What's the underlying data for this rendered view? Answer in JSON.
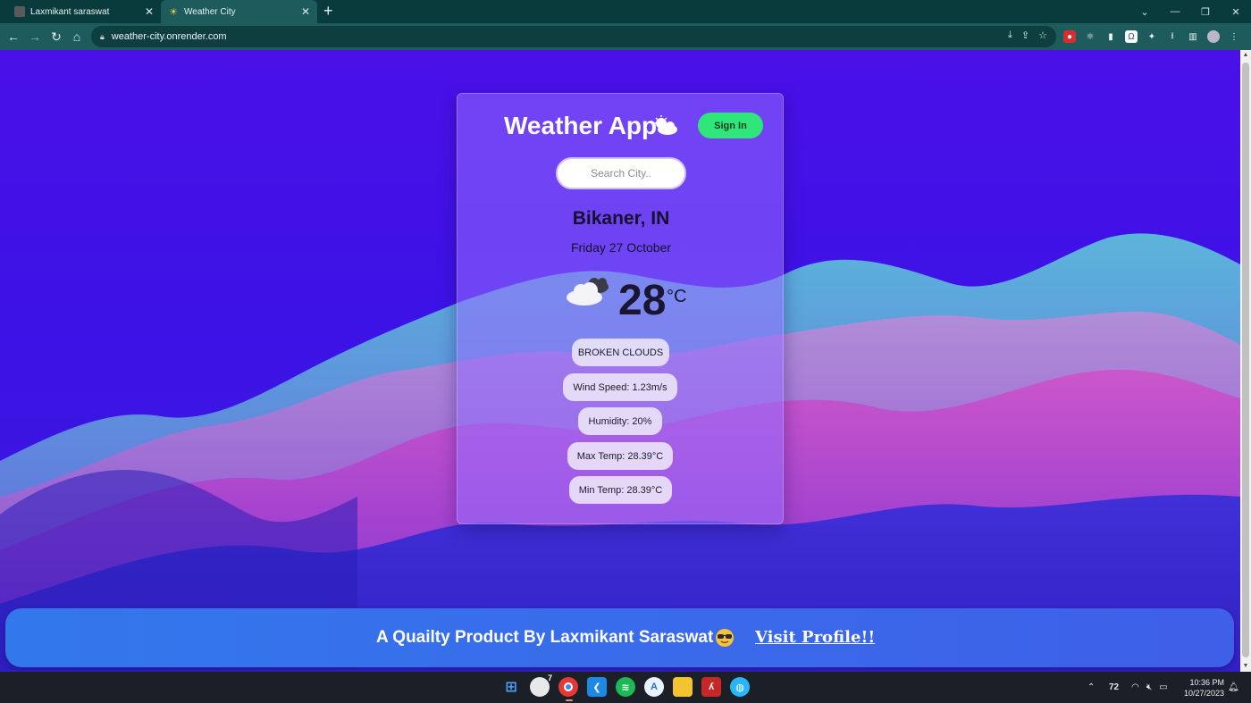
{
  "browser": {
    "tabs": [
      {
        "title": "Laxmikant saraswat",
        "active": false
      },
      {
        "title": "Weather City",
        "active": true
      }
    ],
    "url": "weather-city.onrender.com"
  },
  "app": {
    "title": "Weather App",
    "signin_label": "Sign In",
    "search_placeholder": "Search City..",
    "city": "Bikaner, IN",
    "date": "Friday 27 October",
    "temperature": "28",
    "temperature_unit": "°C",
    "condition": "BROKEN CLOUDS",
    "wind_speed": "Wind Speed: 1.23m/s",
    "humidity": "Humidity: 20%",
    "max_temp": "Max Temp: 28.39°C",
    "min_temp": "Min Temp: 28.39°C"
  },
  "footer": {
    "text": "A Quailty Product By Laxmikant Saraswat",
    "link_label": "Visit Profile!!"
  },
  "taskbar": {
    "badge_count": "7",
    "temperature_tray": "72",
    "time": "10:36 PM",
    "date": "10/27/2023"
  },
  "colors": {
    "background": "#4a10e8",
    "signin": "#2ee67a",
    "footer": "#3278ec",
    "browser_chrome": "#1d5b5c"
  }
}
